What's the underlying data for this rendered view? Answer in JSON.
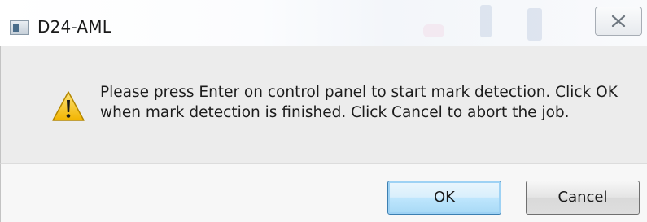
{
  "window": {
    "title": "D24-AML",
    "app_icon": "application-icon",
    "close_icon": "close-icon"
  },
  "message": {
    "icon": "warning-icon",
    "line1": "Please press Enter on control panel to start mark detection. Click OK",
    "line2": "when mark detection is finished. Click Cancel to abort the job."
  },
  "buttons": {
    "ok_label": "OK",
    "cancel_label": "Cancel"
  },
  "colors": {
    "message_background": "#ececec",
    "button_area_background": "#f7f7f7",
    "warning_yellow": "#f5c400",
    "default_button_border": "#3c7fb1"
  }
}
